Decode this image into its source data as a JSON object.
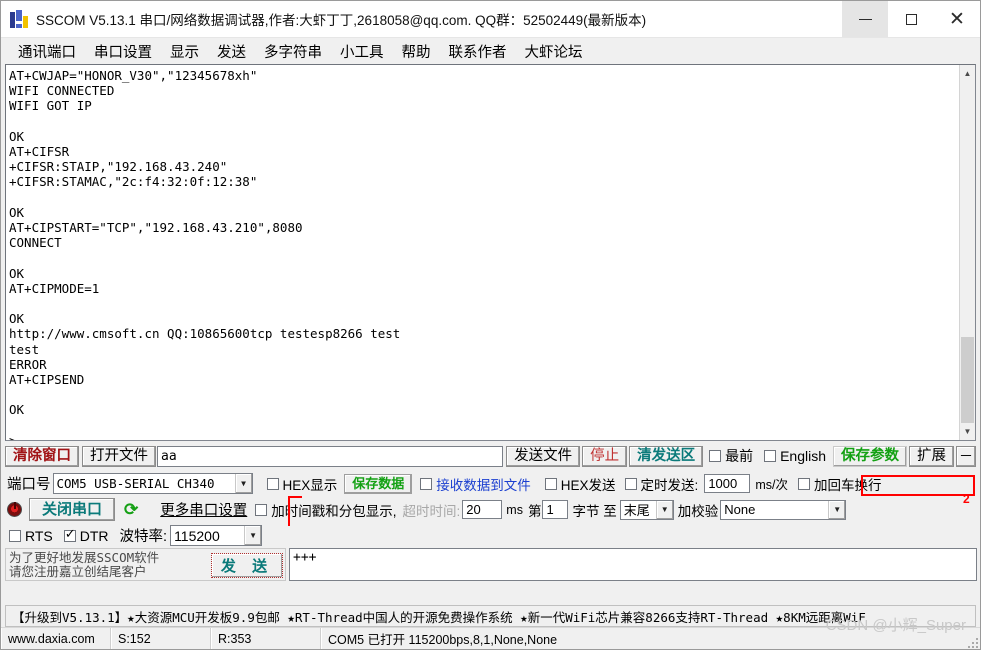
{
  "window": {
    "title": "SSCOM V5.13.1 串口/网络数据调试器,作者:大虾丁丁,2618058@qq.com. QQ群：52502449(最新版本)",
    "icon": "sscom-app-icon",
    "minimize": "minimize-icon",
    "maximize": "maximize-icon",
    "close": "close-icon"
  },
  "menu": {
    "items": [
      {
        "label": "通讯端口",
        "name": "menu-comm-port"
      },
      {
        "label": "串口设置",
        "name": "menu-serial-settings"
      },
      {
        "label": "显示",
        "name": "menu-display"
      },
      {
        "label": "发送",
        "name": "menu-send"
      },
      {
        "label": "多字符串",
        "name": "menu-multi-string"
      },
      {
        "label": "小工具",
        "name": "menu-tools"
      },
      {
        "label": "帮助",
        "name": "menu-help"
      },
      {
        "label": "联系作者",
        "name": "menu-contact-author"
      },
      {
        "label": "大虾论坛",
        "name": "menu-forum"
      }
    ]
  },
  "terminal": {
    "text": "AT+CWJAP=\"HONOR_V30\",\"12345678xh\"\nWIFI CONNECTED\nWIFI GOT IP\n\nOK\nAT+CIFSR\n+CIFSR:STAIP,\"192.168.43.240\"\n+CIFSR:STAMAC,\"2c:f4:32:0f:12:38\"\n\nOK\nAT+CIPSTART=\"TCP\",\"192.168.43.210\",8080\nCONNECT\n\nOK\nAT+CIPMODE=1\n\nOK\nhttp://www.cmsoft.cn QQ:10865600tcp testesp8266 test\ntest\nERROR\nAT+CIPSEND\n\nOK\n\n>"
  },
  "toolbar": {
    "clear_window": "清除窗口",
    "open_file": "打开文件",
    "command_value": "aa",
    "send_file": "发送文件",
    "stop": "停止",
    "clear_send_area": "清发送区",
    "always_on_top": "最前",
    "english": "English",
    "save_params": "保存参数",
    "extend": "扩展",
    "collapse": "－"
  },
  "port_row": {
    "port_label": "端口号",
    "port_value": "COM5 USB-SERIAL CH340",
    "hex_display": "HEX显示",
    "save_data": "保存数据",
    "recv_to_file": "接收数据到文件",
    "hex_send": "HEX发送",
    "timed_send": "定时发送:",
    "timed_value": "1000",
    "timed_unit": "ms/次",
    "add_crlf": "加回车换行"
  },
  "settings_row": {
    "close_port": "关闭串口",
    "refresh": "refresh-icon",
    "power": "power-icon",
    "more_settings": "更多串口设置",
    "timestamp_label": "加时间戳和分包显示,",
    "timeout_label": "超时时间:",
    "timeout_value": "20",
    "timeout_unit": "ms",
    "byte_from_label": "第",
    "byte_from_value": "1",
    "byte_to_label": "字节 至",
    "byte_to_value": "末尾",
    "checksum_label": "加校验",
    "checksum_value": "None"
  },
  "baud_row": {
    "rts": "RTS",
    "dtr": "DTR",
    "baud_label": "波特率:",
    "baud_value": "115200"
  },
  "send_area": {
    "value": "+++"
  },
  "register": {
    "line1": "为了更好地发展SSCOM软件",
    "line2": "请您注册嘉立创结尾客户",
    "send_button": "发 送"
  },
  "annotations": {
    "marker_2": "2"
  },
  "promo": {
    "text": "【升级到V5.13.1】★大资源MCU开发板9.9包邮 ★RT-Thread中国人的开源免费操作系统 ★新一代WiFi芯片兼容8266支持RT-Thread ★8KM远距离WiF"
  },
  "statusbar": {
    "site": "www.daxia.com",
    "sent": "S:152",
    "received": "R:353",
    "port_status": "COM5 已打开  115200bps,8,1,None,None",
    "watermark": "CSDN @小辉_Super"
  },
  "colors": {
    "accent_red": "#a11316",
    "accent_teal": "#0b7a7a",
    "accent_green": "#13a113",
    "annotation": "#ff0000"
  }
}
